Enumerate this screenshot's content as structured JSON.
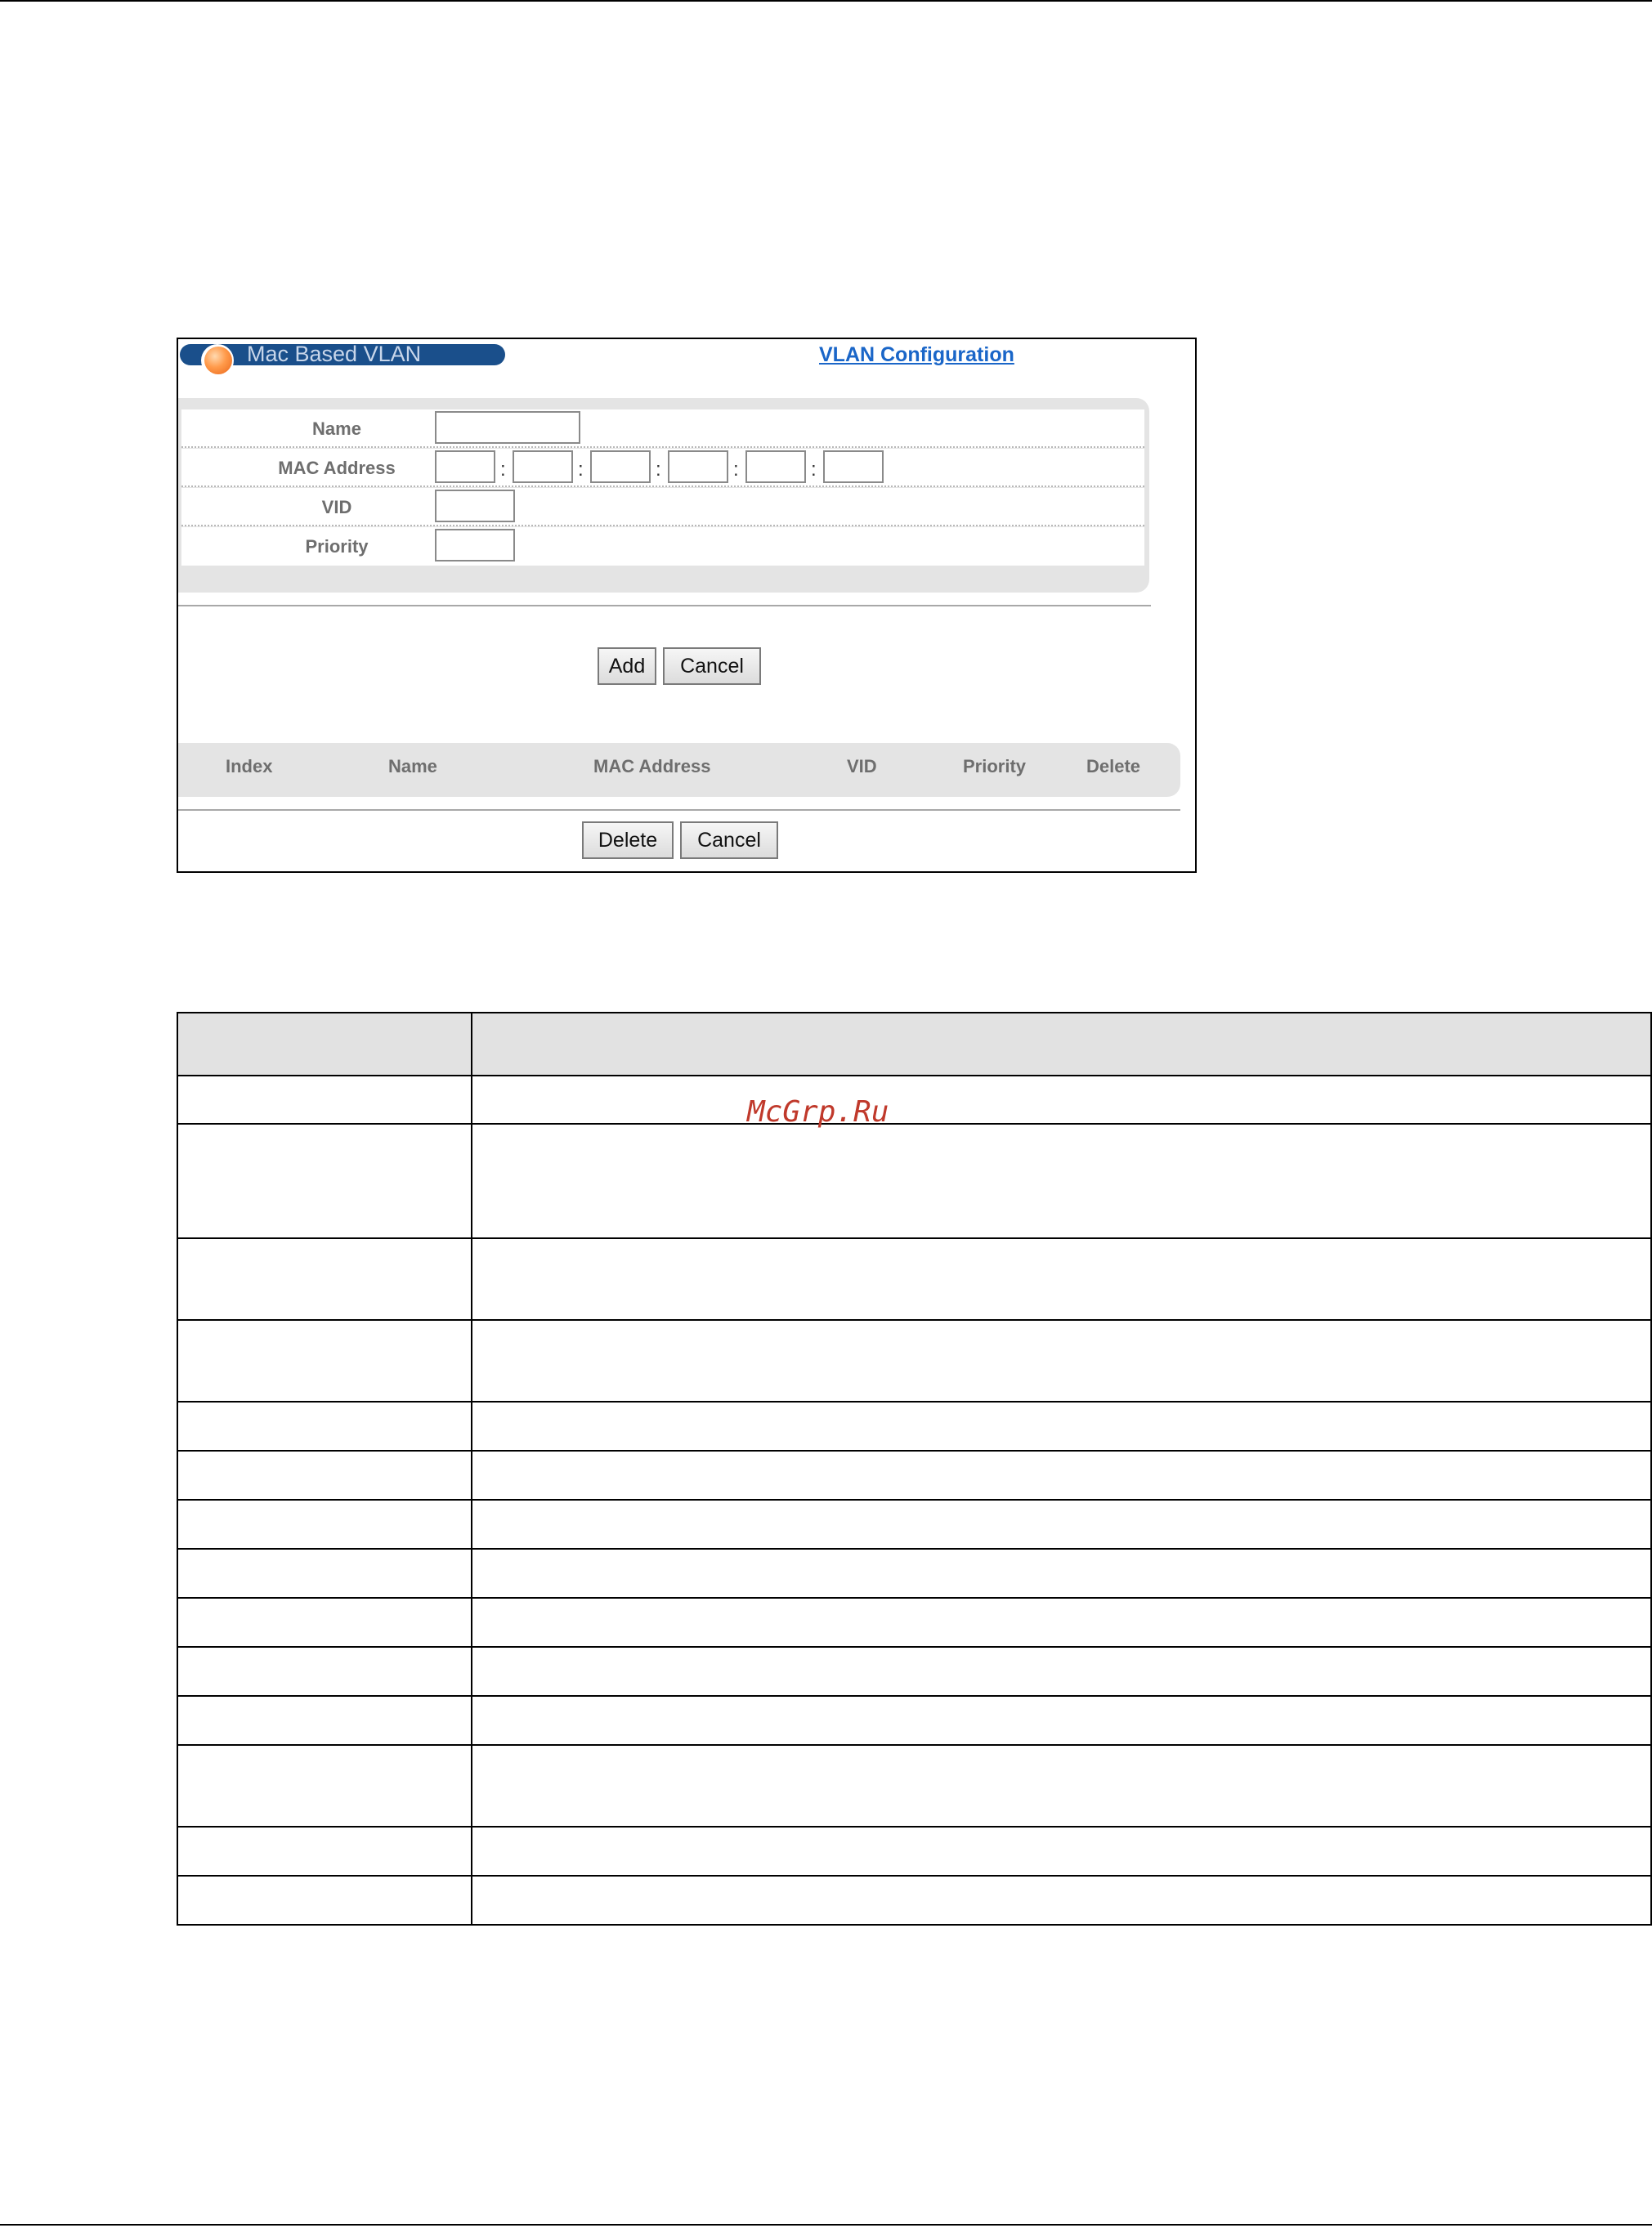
{
  "panel": {
    "title": "Mac Based VLAN",
    "link": "VLAN Configuration",
    "form": {
      "name_label": "Name",
      "mac_label": "MAC Address",
      "mac_separator": ":",
      "vid_label": "VID",
      "priority_label": "Priority"
    },
    "add_button": "Add",
    "cancel_button": "Cancel",
    "list_columns": [
      "Index",
      "Name",
      "MAC Address",
      "VID",
      "Priority",
      "Delete"
    ],
    "delete_button": "Delete",
    "cancel_button_2": "Cancel"
  },
  "watermark": "McGrp.Ru",
  "colors": {
    "title_bar": "#1a4f8b",
    "link": "#1a66c8",
    "panel_bg": "#e4e4e4",
    "watermark": "#c0392b"
  },
  "icons": {
    "title_orb": "orange-orb-icon"
  }
}
